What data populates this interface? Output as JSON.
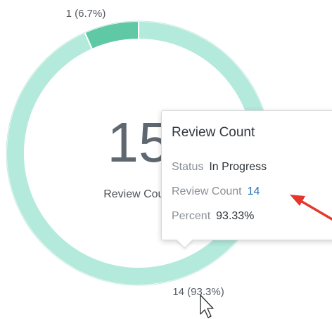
{
  "chart_data": {
    "type": "pie",
    "variant": "donut",
    "total": 15,
    "center_label": "Review Count",
    "slices": [
      {
        "name": "In Progress",
        "value": 14,
        "label": "14 (93.3%)",
        "color": "#b3eadb"
      },
      {
        "name": "",
        "value": 1,
        "label": "1 (6.7%)",
        "color": "#5fc8a5"
      }
    ],
    "start_angle_deg": 0,
    "highlight_slice": 0
  },
  "tooltip": {
    "title": "Review Count",
    "rows": [
      {
        "key": "Status",
        "value": "In Progress"
      },
      {
        "key": "Review Count",
        "value": "14"
      },
      {
        "key": "Percent",
        "value": "93.33%"
      }
    ]
  },
  "annotation": {
    "arrow_color": "#e5362c",
    "icon": "arrow-annotation-icon"
  },
  "cursor": {
    "icon": "mouse-pointer-icon"
  },
  "colors": {
    "track_stroke": "#9ddcca"
  }
}
